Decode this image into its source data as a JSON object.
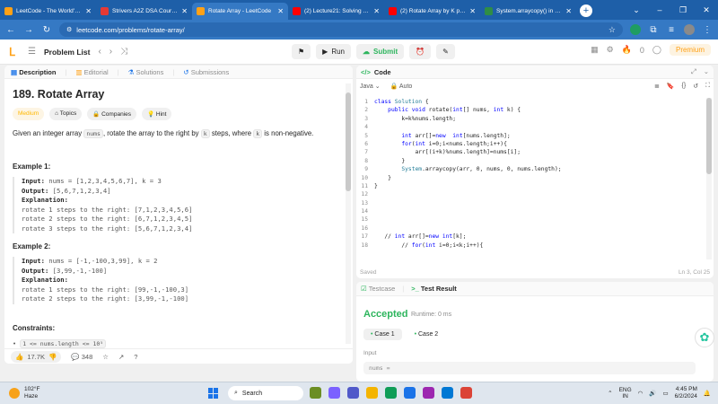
{
  "browser": {
    "tabs": [
      {
        "label": "LeetCode - The World's Le",
        "color": "#ffa116",
        "active": false
      },
      {
        "label": "Strivers A2Z DSA Course/S",
        "color": "#e53935",
        "active": false
      },
      {
        "label": "Rotate Array - LeetCode",
        "color": "#ffa116",
        "active": true
      },
      {
        "label": "(2) Lecture21: Solving Leet",
        "color": "#ff0000",
        "active": false
      },
      {
        "label": "(2) Rotate Array by K place",
        "color": "#ff0000",
        "active": false
      },
      {
        "label": "System.arraycopy() in Java",
        "color": "#2f8d46",
        "active": false
      }
    ],
    "new_tab": "+",
    "url": "leetcode.com/problems/rotate-array/"
  },
  "lc": {
    "problem_list": "Problem List",
    "run": "Run",
    "submit": "Submit",
    "points": "0",
    "premium": "Premium"
  },
  "left": {
    "tabs": [
      "Description",
      "Editorial",
      "Solutions",
      "Submissions"
    ],
    "title": "189. Rotate Array",
    "chips": [
      "Medium",
      "Topics",
      "Companies",
      "Hint"
    ],
    "desc_pre": "Given an integer array ",
    "desc_code1": "nums",
    "desc_mid": ", rotate the array to the right by ",
    "desc_code2": "k",
    "desc_mid2": " steps, where ",
    "desc_code3": "k",
    "desc_post": " is non-negative.",
    "examples": [
      {
        "heading": "Example 1:",
        "input_label": "Input:",
        "input": " nums = [1,2,3,4,5,6,7], k = 3",
        "output_label": "Output:",
        "output": " [5,6,7,1,2,3,4]",
        "expl_label": "Explanation:",
        "lines": [
          "rotate 1 steps to the right: [7,1,2,3,4,5,6]",
          "rotate 2 steps to the right: [6,7,1,2,3,4,5]",
          "rotate 3 steps to the right: [5,6,7,1,2,3,4]"
        ]
      },
      {
        "heading": "Example 2:",
        "input_label": "Input:",
        "input": " nums = [-1,-100,3,99], k = 2",
        "output_label": "Output:",
        "output": " [3,99,-1,-100]",
        "expl_label": "Explanation:",
        "lines": [
          "rotate 1 steps to the right: [99,-1,-100,3]",
          "rotate 2 steps to the right: [3,99,-1,-100]"
        ]
      }
    ],
    "constraints_heading": "Constraints:",
    "constraint1": "1 <= nums.length <= 10⁵",
    "likes": "17.7K",
    "comments": "348"
  },
  "code": {
    "header": "Code",
    "language": "Java",
    "auto": "Auto",
    "lines": [
      {
        "n": "1",
        "t": "class Solution {"
      },
      {
        "n": "2",
        "t": "    public void rotate(int[] nums, int k) {"
      },
      {
        "n": "3",
        "t": "        k=k%nums.length;"
      },
      {
        "n": "4",
        "t": ""
      },
      {
        "n": "5",
        "t": "        int arr[]=new  int[nums.length];"
      },
      {
        "n": "6",
        "t": "        for(int i=0;i<nums.length;i++){"
      },
      {
        "n": "7",
        "t": "            arr[(i+k)%nums.length]=nums[i];"
      },
      {
        "n": "8",
        "t": "        }"
      },
      {
        "n": "9",
        "t": "        System.arraycopy(arr, 0, nums, 0, nums.length);"
      },
      {
        "n": "10",
        "t": "    }"
      },
      {
        "n": "11",
        "t": "}"
      },
      {
        "n": "12",
        "t": ""
      },
      {
        "n": "13",
        "t": ""
      },
      {
        "n": "14",
        "t": ""
      },
      {
        "n": "15",
        "t": ""
      },
      {
        "n": "16",
        "t": ""
      },
      {
        "n": "17",
        "t": "   // int arr[]=new int[k];"
      },
      {
        "n": "18",
        "t": "        // for(int i=0;i<k;i++){"
      }
    ],
    "saved": "Saved",
    "cursor": "Ln 3, Col 25"
  },
  "result": {
    "tab_testcase": "Testcase",
    "tab_result": "Test Result",
    "status": "Accepted",
    "runtime": "Runtime: 0 ms",
    "case1": "Case 1",
    "case2": "Case 2",
    "input_label": "Input",
    "input_value": "nums ="
  },
  "taskbar": {
    "temp": "102°F",
    "condition": "Haze",
    "search": "Search",
    "lang1": "ENG",
    "lang2": "IN",
    "time": "4:45 PM",
    "date": "6/2/2024"
  }
}
